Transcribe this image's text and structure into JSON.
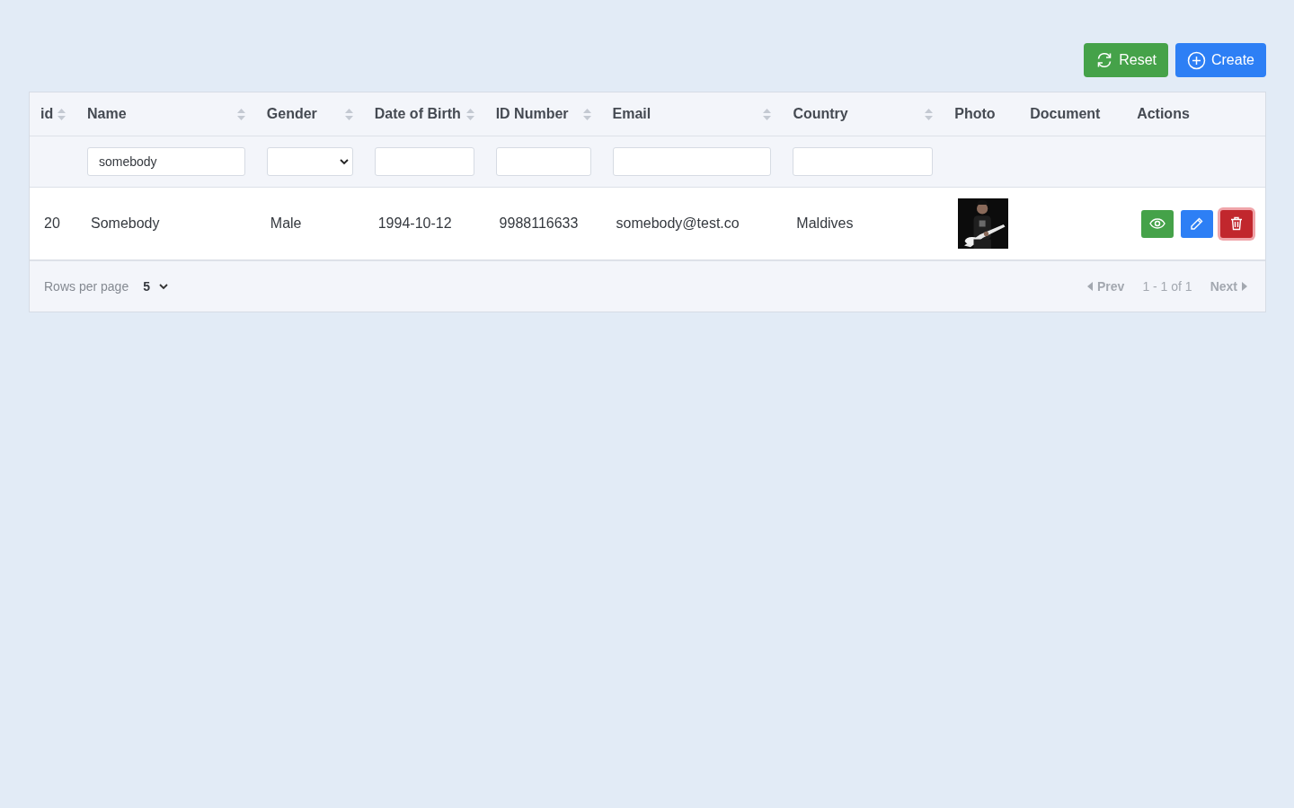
{
  "toolbar": {
    "buttons": [
      {
        "kind": "reset",
        "label": "Reset"
      },
      {
        "kind": "create",
        "label": "Create"
      }
    ]
  },
  "table": {
    "columns": [
      {
        "label": "id",
        "sortable": true
      },
      {
        "label": "Name",
        "sortable": true,
        "filter": {
          "kind": "text",
          "value": "somebody"
        }
      },
      {
        "label": "Gender",
        "sortable": true,
        "filter": {
          "kind": "select"
        }
      },
      {
        "label": "Date of Birth",
        "sortable": true,
        "filter": {
          "kind": "text"
        }
      },
      {
        "label": "ID Number",
        "sortable": true,
        "filter": {
          "kind": "text"
        }
      },
      {
        "label": "Email",
        "sortable": true,
        "filter": {
          "kind": "text"
        }
      },
      {
        "label": "Country",
        "sortable": true,
        "filter": {
          "kind": "text"
        }
      },
      {
        "label": "Photo",
        "sortable": false
      },
      {
        "label": "Document",
        "sortable": false
      },
      {
        "label": "Actions",
        "sortable": false
      }
    ],
    "rows": [
      {
        "id": "20",
        "name": "Somebody",
        "gender": "Male",
        "date_of_birth": "1994-10-12",
        "id_number": "9988116633",
        "email": "somebody@test.co",
        "country": "Maldives",
        "actions": [
          {
            "kind": "view",
            "focused": false
          },
          {
            "kind": "edit",
            "focused": false
          },
          {
            "kind": "delete",
            "focused": true
          }
        ]
      }
    ]
  },
  "footer": {
    "rows_per_page_label": "Rows per page",
    "rows_per_page": "5",
    "prev": {
      "label": "Prev",
      "disabled": true
    },
    "range": "1 - 1 of 1",
    "next": {
      "label": "Next",
      "disabled": true
    }
  }
}
